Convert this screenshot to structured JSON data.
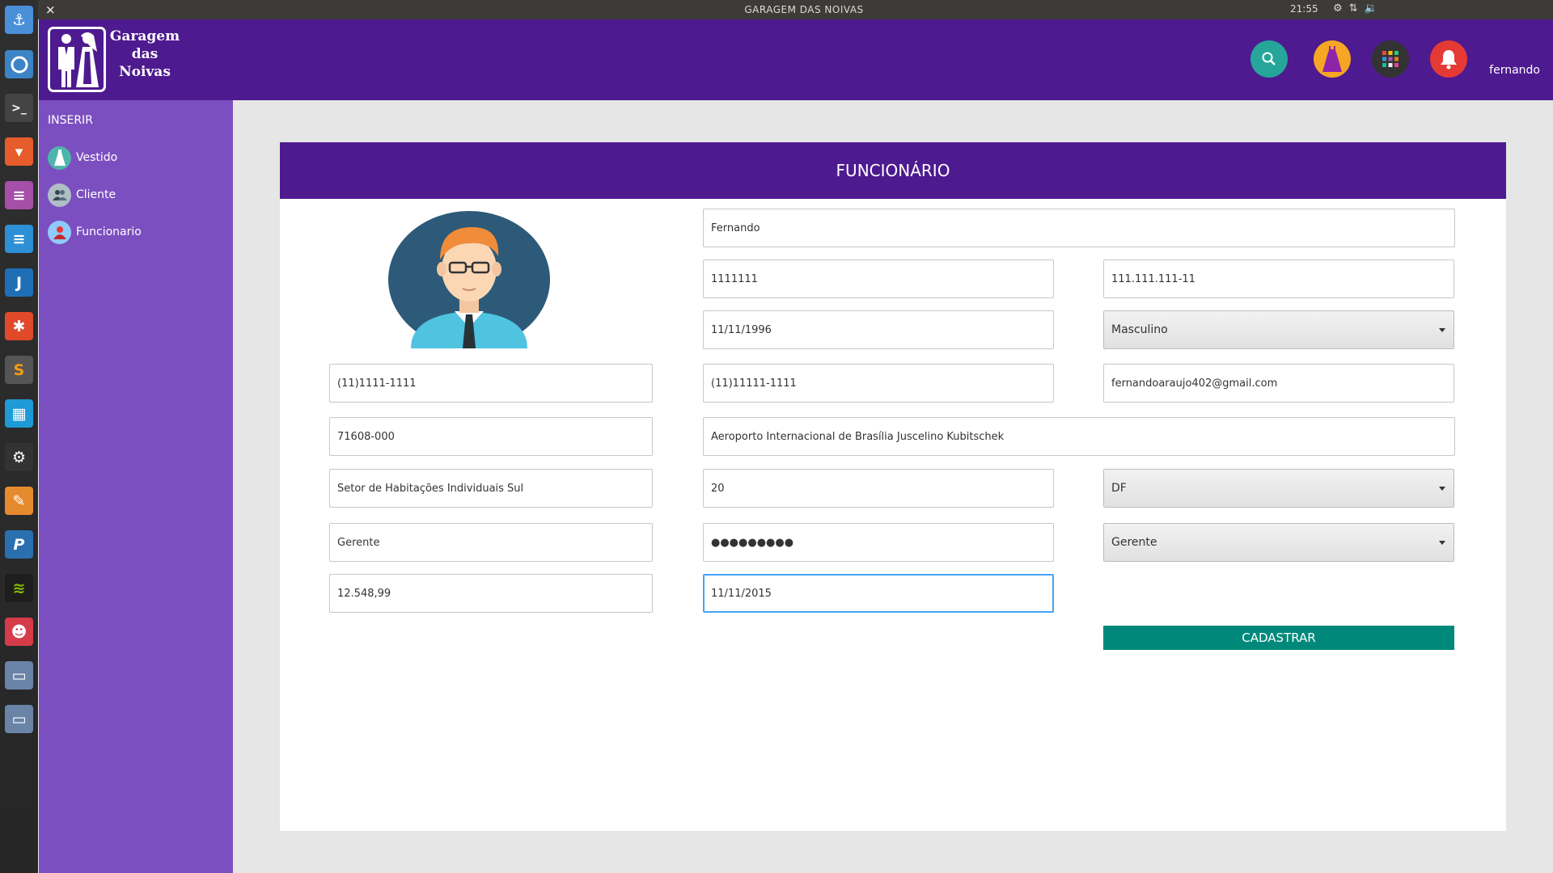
{
  "window": {
    "title": "GARAGEM DAS NOIVAS",
    "close_glyph": "×",
    "clock": "21:55",
    "tray_icons": [
      "gear-icon",
      "network-icon",
      "volume-icon"
    ]
  },
  "launcher": {
    "apps": [
      "anchor-app-icon",
      "chromium-icon",
      "terminal-icon",
      "impress-icon",
      "writer-icon",
      "document-icon",
      "intellij-icon",
      "xampp-icon",
      "sublime-icon",
      "monitor-icon",
      "steam-icon",
      "gimp-icon",
      "pencil-icon",
      "spotify-icon",
      "panda-icon",
      "window-icon",
      "window-icon-2"
    ]
  },
  "header": {
    "logo_line1": "Garagem",
    "logo_line2": "das",
    "logo_line3": "Noivas",
    "username": "fernando",
    "buttons": [
      {
        "name": "search-icon",
        "color": "#26a69a"
      },
      {
        "name": "dress-icon",
        "color": "#f5a623"
      },
      {
        "name": "apps-grid-icon",
        "color": "#333333"
      },
      {
        "name": "bell-icon",
        "color": "#e53935"
      }
    ]
  },
  "sidebar": {
    "section": "INSERIR",
    "items": [
      {
        "label": "Vestido",
        "icon": "dress-icon"
      },
      {
        "label": "Cliente",
        "icon": "clients-icon"
      },
      {
        "label": "Funcionario",
        "icon": "employee-icon"
      }
    ]
  },
  "form": {
    "title": "FUNCIONÁRIO",
    "avatar": "employee-avatar",
    "nome": "Fernando",
    "rg": "1111111",
    "cpf": "111.111.111-11",
    "nascimento": "11/11/1996",
    "sexo": "Masculino",
    "telefone": "(11)1111-1111",
    "celular": "(11)11111-1111",
    "email": "fernandoaraujo402@gmail.com",
    "cep": "71608-000",
    "endereco": "Aeroporto Internacional de Brasília Juscelino Kubitschek",
    "bairro": "Setor de Habitações Individuais Sul",
    "numero": "20",
    "uf": "DF",
    "login": "Gerente",
    "senha": "●●●●●●●●●",
    "cargo": "Gerente",
    "salario": "12.548,99",
    "admissao": "11/11/2015",
    "submit": "CADASTRAR"
  },
  "colors": {
    "header": "#4e1a8f",
    "sidebar": "#7c4fc0",
    "submit": "#00897b",
    "focus": "#42a5f5"
  }
}
